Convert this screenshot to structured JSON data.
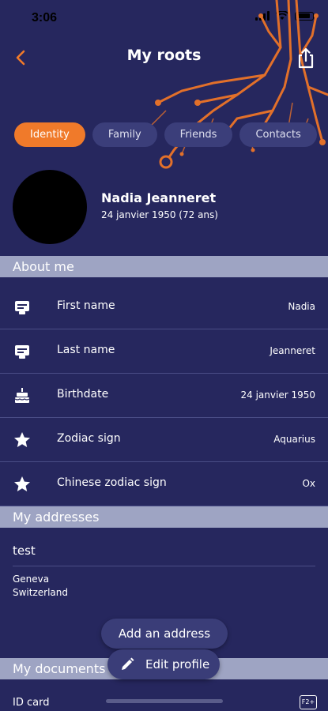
{
  "status_bar": {
    "time": "3:06"
  },
  "header": {
    "title": "My roots",
    "back_icon": "chevron-left-icon",
    "share_icon": "share-icon"
  },
  "tabs": [
    {
      "label": "Identity",
      "active": true
    },
    {
      "label": "Family",
      "active": false
    },
    {
      "label": "Friends",
      "active": false
    },
    {
      "label": "Contacts",
      "active": false
    }
  ],
  "profile": {
    "name": "Nadia Jeanneret",
    "dob": "24 janvier 1950 (72 ans)"
  },
  "sections": {
    "about": "About me",
    "addresses": "My addresses",
    "documents": "My documents"
  },
  "about_rows": [
    {
      "icon": "badge-icon",
      "label": "First name",
      "value": "Nadia"
    },
    {
      "icon": "badge-icon",
      "label": "Last name",
      "value": "Jeanneret"
    },
    {
      "icon": "cake-icon",
      "label": "Birthdate",
      "value": "24 janvier 1950"
    },
    {
      "icon": "star-icon",
      "label": "Zodiac sign",
      "value": "Aquarius"
    },
    {
      "icon": "star-icon",
      "label": "Chinese zodiac sign",
      "value": "Ox"
    }
  ],
  "address": {
    "name": "test",
    "city": "Geneva",
    "country": "Switzerland"
  },
  "buttons": {
    "add_address": "Add an address",
    "edit_profile": "Edit profile"
  },
  "documents": [
    {
      "label": "ID card",
      "icon_text": "F2+"
    }
  ],
  "colors": {
    "background": "#26275e",
    "accent": "#f07a2a",
    "section": "#9ea4c3",
    "tab": "#3b3e7a"
  }
}
